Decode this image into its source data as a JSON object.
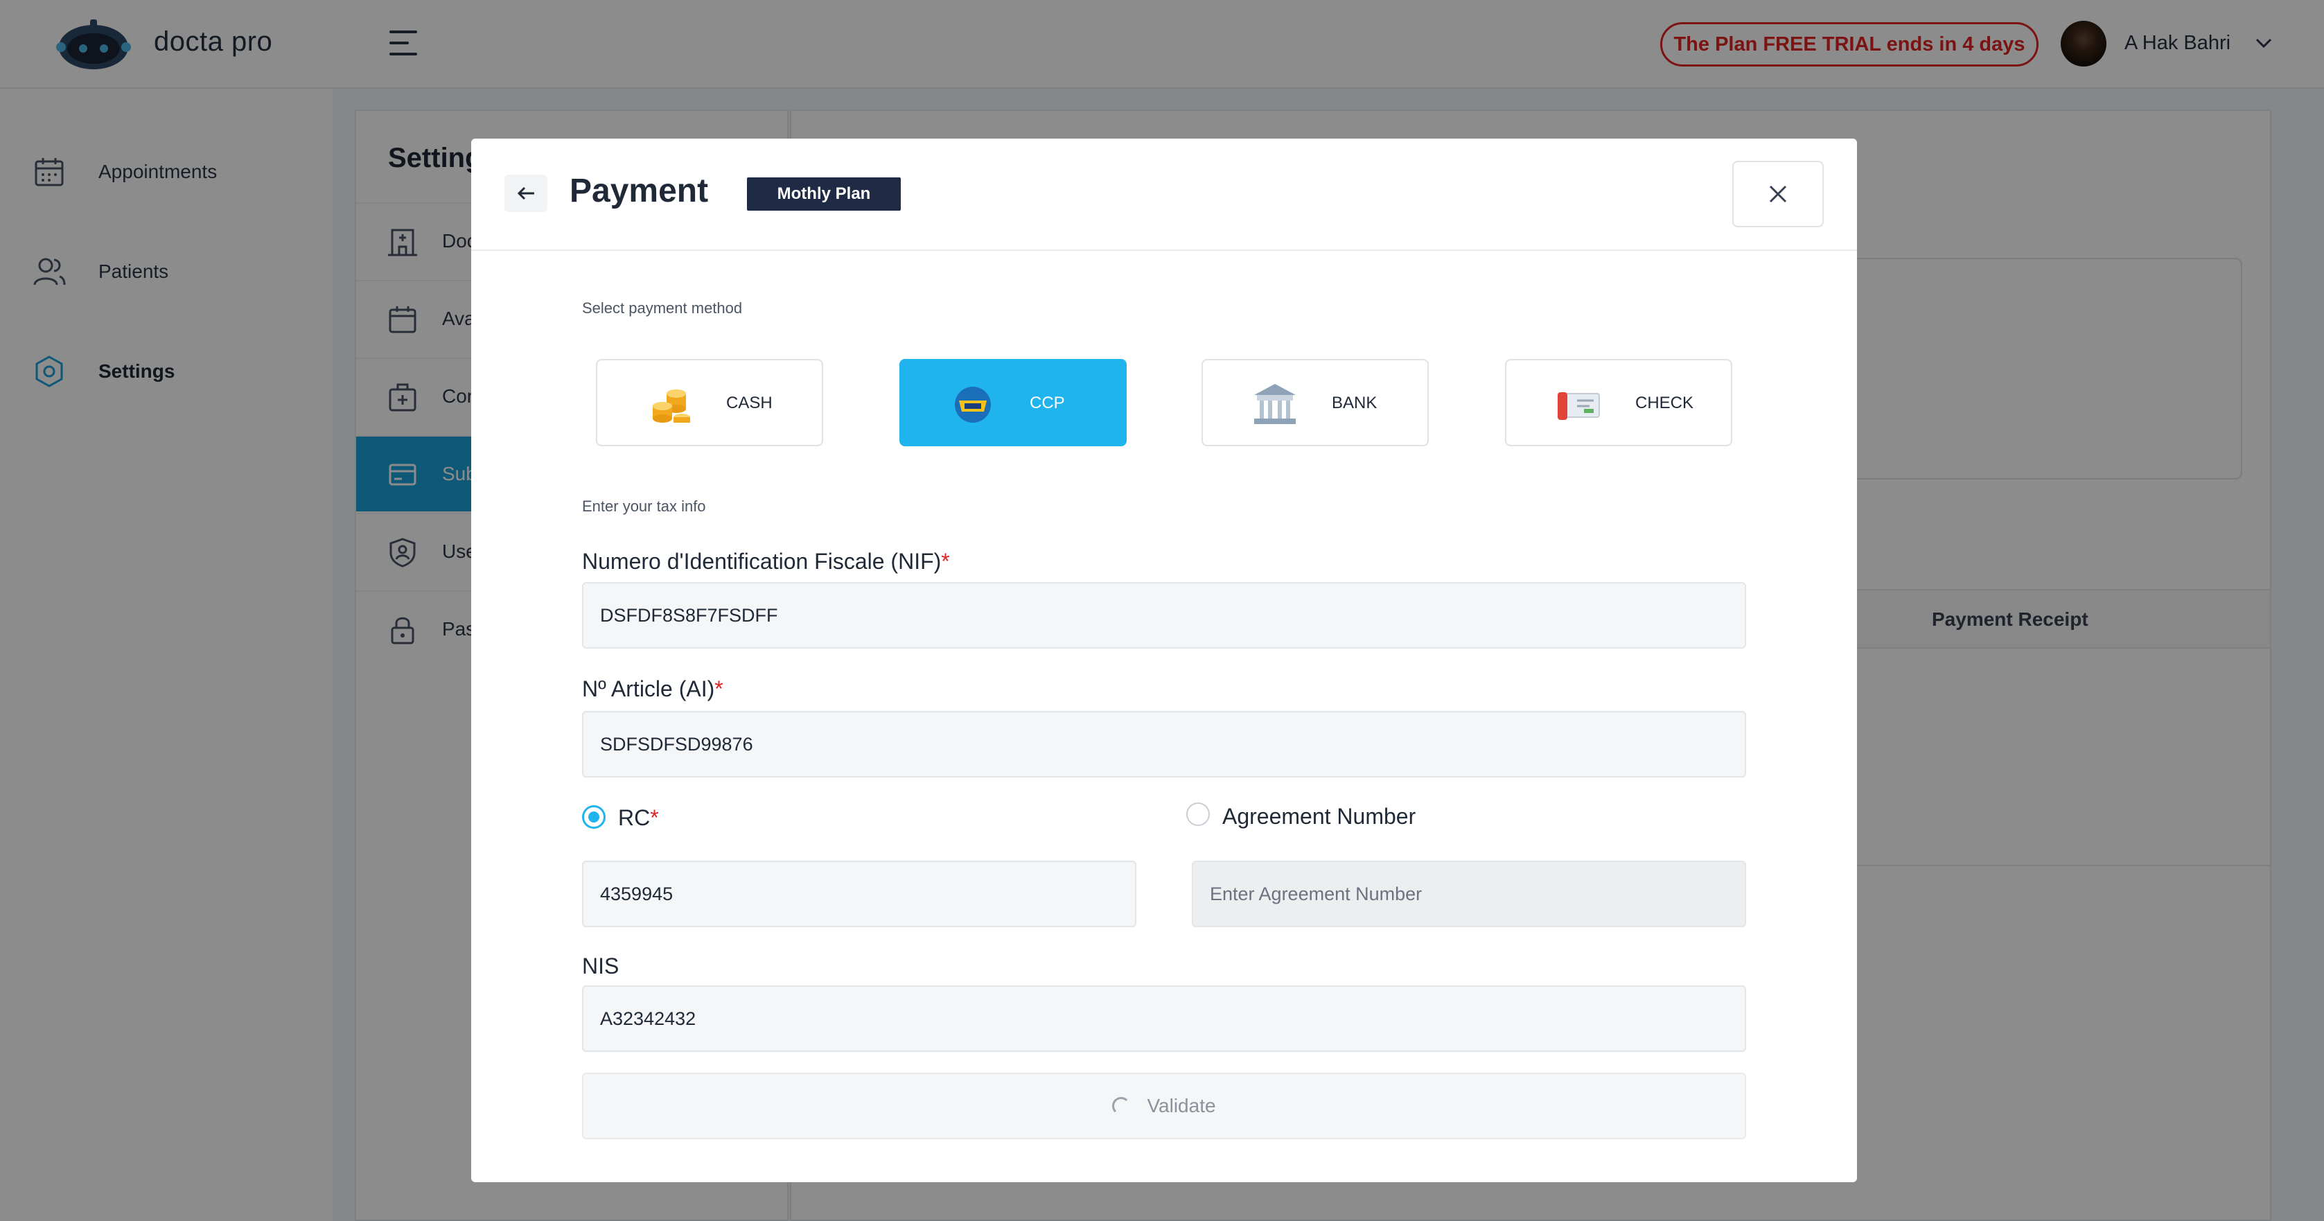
{
  "app": {
    "brand": "docta pro",
    "trial_notice": "The Plan FREE TRIAL ends in 4 days",
    "user_name": "A Hak Bahri"
  },
  "sidebar": {
    "items": [
      {
        "label": "Appointments",
        "icon": "calendar-icon"
      },
      {
        "label": "Patients",
        "icon": "users-icon"
      },
      {
        "label": "Settings",
        "icon": "settings-icon",
        "active": true
      }
    ]
  },
  "settings": {
    "title": "Setting",
    "items": [
      {
        "label": "Doc",
        "icon": "building-icon"
      },
      {
        "label": "Ava",
        "icon": "calendar-icon"
      },
      {
        "label": "Con",
        "icon": "medical-kit-icon"
      },
      {
        "label": "Sub",
        "icon": "card-icon",
        "active": true
      },
      {
        "label": "Use",
        "icon": "shield-user-icon"
      },
      {
        "label": "Pas",
        "icon": "lock-icon"
      }
    ]
  },
  "background_table": {
    "header": "Payment Receipt"
  },
  "modal": {
    "title": "Payment",
    "plan_badge": "Mothly Plan",
    "payment_method_label": "Select payment method",
    "methods": [
      {
        "label": "CASH",
        "icon": "coins-icon",
        "selected": false
      },
      {
        "label": "CCP",
        "icon": "postal-icon",
        "selected": true
      },
      {
        "label": "BANK",
        "icon": "bank-icon",
        "selected": false
      },
      {
        "label": "CHECK",
        "icon": "check-icon",
        "selected": false
      }
    ],
    "tax_info_label": "Enter your tax info",
    "nif": {
      "label": "Numero d'Identification Fiscale (NIF)",
      "value": "DSFDF8S8F7FSDFF"
    },
    "article": {
      "label": "Nº Article (AI)",
      "value": "SDFSDFSD99876"
    },
    "rc": {
      "label": "RC",
      "value": "4359945",
      "checked": true
    },
    "agreement": {
      "label": "Agreement Number",
      "placeholder": "Enter Agreement Number",
      "checked": false
    },
    "nis": {
      "label": "NIS",
      "value": "A32342432"
    },
    "validate_label": "Validate"
  },
  "colors": {
    "accent": "#1fb4ee",
    "active_nav": "#1aa3d9",
    "badge": "#1f2a44",
    "danger": "#e02424"
  }
}
